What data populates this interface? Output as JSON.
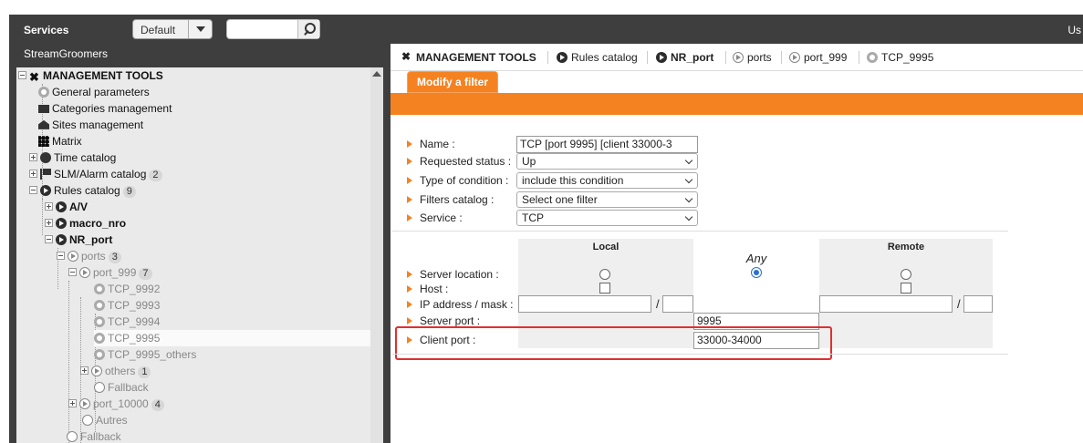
{
  "header": {
    "services_label": "Services",
    "profile_select": "Default",
    "user_label": "Us"
  },
  "sidebar": {
    "org": "StreamGroomers",
    "tree": {
      "root": "MANAGEMENT TOOLS",
      "general": "General parameters",
      "categories": "Categories management",
      "sites": "Sites management",
      "matrix": "Matrix",
      "time": "Time catalog",
      "slm": "SLM/Alarm catalog",
      "slm_count": "2",
      "rules": "Rules catalog",
      "rules_count": "9",
      "av": "A/V",
      "macro": "macro_nro",
      "nrport": "NR_port",
      "ports": "ports",
      "ports_count": "3",
      "port999": "port_999",
      "port999_count": "7",
      "tcp9992": "TCP_9992",
      "tcp9993": "TCP_9993",
      "tcp9994": "TCP_9994",
      "tcp9995": "TCP_9995",
      "tcp9995o": "TCP_9995_others",
      "others": "others",
      "others_count": "1",
      "fallback1": "Fallback",
      "port10000": "port_10000",
      "port10000_count": "4",
      "autres": "Autres",
      "fallback2": "Fallback"
    }
  },
  "tabs": {
    "t1": "MANAGEMENT TOOLS",
    "t2": "Rules catalog",
    "t3": "NR_port",
    "t4": "ports",
    "t5": "port_999",
    "t6": "TCP_9995"
  },
  "subtab": "Modify a filter",
  "form": {
    "name_label": "Name :",
    "name_value": "TCP [port 9995] [client 33000-3",
    "status_label": "Requested status :",
    "status_value": "Up",
    "condition_label": "Type of condition :",
    "condition_value": "include this condition",
    "filters_label": "Filters catalog :",
    "filters_value": "Select one filter",
    "service_label": "Service :",
    "service_value": "TCP",
    "local_head": "Local",
    "any_head": "Any",
    "remote_head": "Remote",
    "server_location_label": "Server location :",
    "host_label": "Host :",
    "ip_label": "IP address / mask :",
    "server_port_label": "Server port :",
    "server_port_value": "9995",
    "client_port_label": "Client port :",
    "client_port_value": "33000-34000",
    "slash": "/"
  },
  "colors": {
    "accent": "#f58220",
    "header_bg": "#3e3e3e",
    "highlight": "#e03030"
  }
}
